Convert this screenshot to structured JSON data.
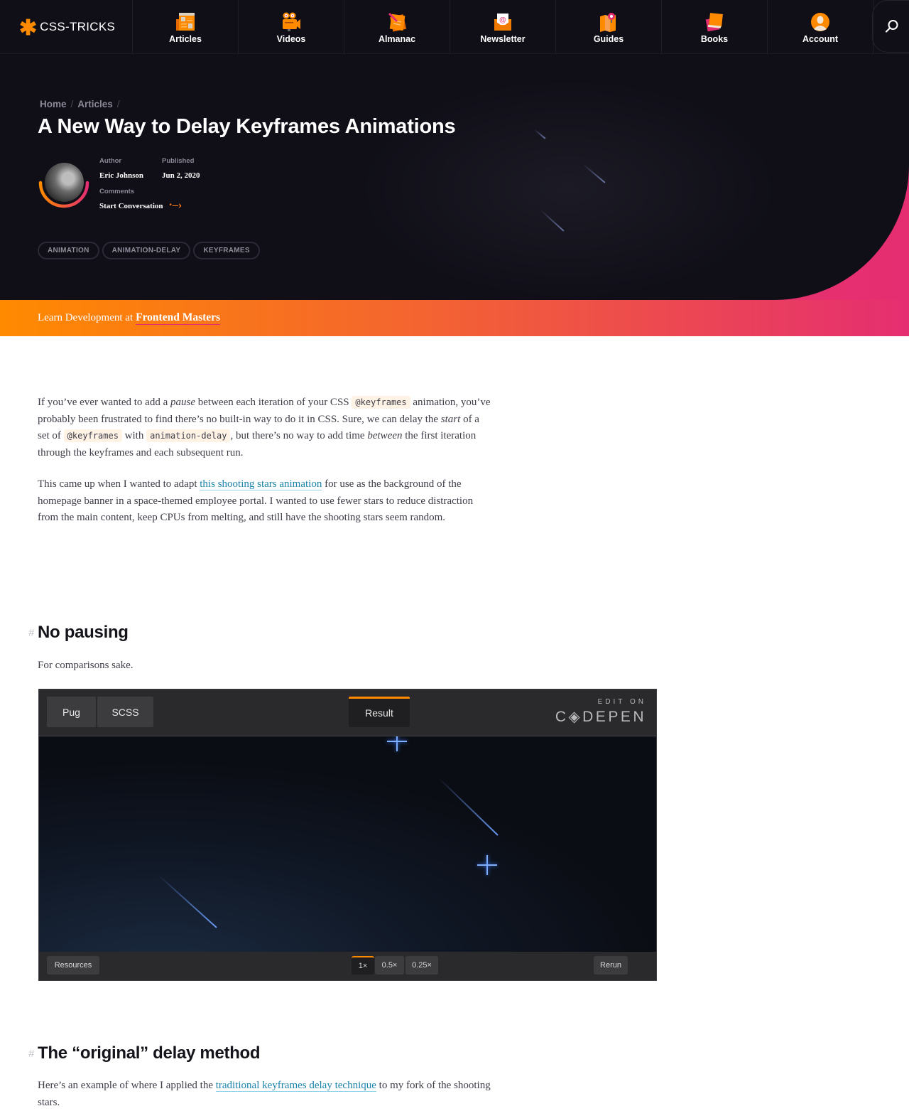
{
  "header": {
    "logo_text": "CSS-TRICKS",
    "nav": [
      {
        "label": "Articles",
        "icon": "newspaper-icon"
      },
      {
        "label": "Videos",
        "icon": "video-camera-icon"
      },
      {
        "label": "Almanac",
        "icon": "almanac-notebook-icon"
      },
      {
        "label": "Newsletter",
        "icon": "envelope-icon"
      },
      {
        "label": "Guides",
        "icon": "map-icon"
      },
      {
        "label": "Books",
        "icon": "books-icon"
      },
      {
        "label": "Account",
        "icon": "user-icon"
      }
    ],
    "search_icon": "search-icon"
  },
  "hero": {
    "breadcrumb": [
      "Home",
      "Articles"
    ],
    "title": "A New Way to Delay Keyframes Animations",
    "author_label": "Author",
    "author": "Eric Johnson",
    "published_label": "Published",
    "published": "Jun 2, 2020",
    "comments_label": "Comments",
    "comments_link": "Start Conversation",
    "tags": [
      "ANIMATION",
      "ANIMATION-DELAY",
      "KEYFRAMES"
    ]
  },
  "promo": {
    "prefix": "Learn Development at",
    "brand": "Frontend Masters"
  },
  "article": {
    "p1": {
      "t1": "If you’ve ever wanted to add a ",
      "em1": "pause",
      "t2": " between each iteration of your CSS ",
      "code1": "@keyframes",
      "t3": " animation, you’ve probably been frustrated to find there’s no built-in way to do it in CSS. Sure, we can delay the ",
      "em2": "start",
      "t4": " of a set of ",
      "code2": "@keyframes",
      "t5": " with ",
      "code3": "animation-delay",
      "t6": ", but there’s no way to add time ",
      "em3": "between",
      "t7": " the first iteration through the keyframes and each subsequent run."
    },
    "p2": {
      "t1": "This came up when I wanted to adapt ",
      "link": "this shooting stars animation",
      "t2": " for use as the background of the homepage banner in a space-themed employee portal. I wanted to use fewer stars to reduce distraction from the main content, keep CPUs from melting, and still have the shooting stars seem random."
    },
    "h2_1": "No pausing",
    "h2_hash": "#",
    "p3": "For comparisons sake.",
    "h2_2": "The “original” delay method",
    "p4": {
      "t1": "Here’s an example of where I applied the ",
      "link": "traditional keyframes delay technique",
      "t2": " to my fork of the shooting stars."
    }
  },
  "codepen": {
    "tabs": [
      "Pug",
      "SCSS"
    ],
    "result_tab": "Result",
    "edit_on": "EDIT ON",
    "brand": "C◈DEPEN",
    "resources": "Resources",
    "speeds": [
      "1×",
      "0.5×",
      "0.25×"
    ],
    "active_speed": "1×",
    "rerun": "Rerun"
  }
}
